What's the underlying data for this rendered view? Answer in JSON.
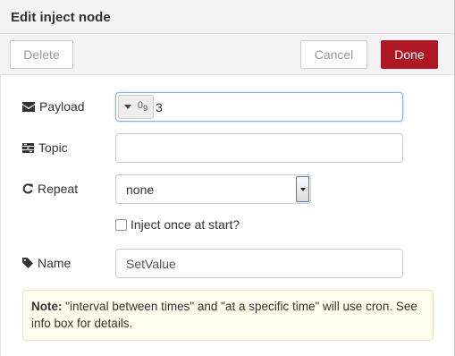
{
  "tray": {
    "title": "Edit inject node"
  },
  "toolbar": {
    "delete_label": "Delete",
    "cancel_label": "Cancel",
    "done_label": "Done"
  },
  "form": {
    "payload": {
      "label": "Payload",
      "icon": "envelope-icon",
      "type_icon": "number-type-icon",
      "type_icon_text": "0",
      "type_icon_sub": "9",
      "value": "3"
    },
    "topic": {
      "label": "Topic",
      "icon": "tasks-icon",
      "value": ""
    },
    "repeat": {
      "label": "Repeat",
      "icon": "repeat-icon",
      "selected": "none"
    },
    "inject_once": {
      "label": "Inject once at start?",
      "checked": false
    },
    "name": {
      "label": "Name",
      "icon": "tag-icon",
      "value": "SetValue"
    }
  },
  "note": {
    "bold": "Note:",
    "text": " \"interval between times\" and \"at a specific time\" will use cron. See info box for details."
  },
  "colors": {
    "done_button": "#ad1625",
    "note_background": "#ffffee",
    "header_background": "#f3f3f3"
  }
}
